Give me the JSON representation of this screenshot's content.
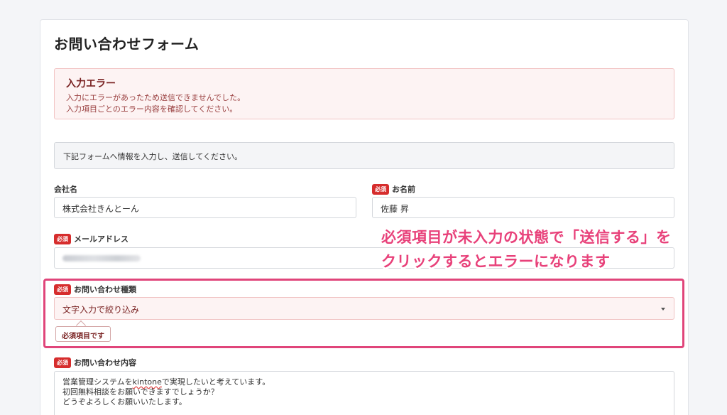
{
  "form": {
    "title": "お問い合わせフォーム",
    "error": {
      "title": "入力エラー",
      "line1": "入力にエラーがあったため送信できませんでした。",
      "line2": "入力項目ごとのエラー内容を確認してください。"
    },
    "info": "下記フォームへ情報を入力し、送信してください。",
    "required_badge": "必須",
    "company": {
      "label": "会社名",
      "value": "株式会社きんとーん"
    },
    "name": {
      "label": "お名前",
      "value": "佐藤 昇"
    },
    "email": {
      "label": "メールアドレス"
    },
    "inquiry_type": {
      "label": "お問い合わせ種類",
      "placeholder": "文字入力で絞り込み",
      "error": "必須項目です"
    },
    "inquiry_content": {
      "label": "お問い合わせ内容",
      "line1_pre": "営業管理システムを",
      "line1_word": "kintone",
      "line1_post": "で実現したいと考えています。",
      "line2": "初回無料相談をお願いできますでしょうか？",
      "line3": "どうぞよろしくお願いいたします。"
    }
  },
  "annotation": {
    "line1": "必須項目が未入力の状態で「送信する」を",
    "line2": "クリックするとエラーになります",
    "color": "#e8417a"
  }
}
